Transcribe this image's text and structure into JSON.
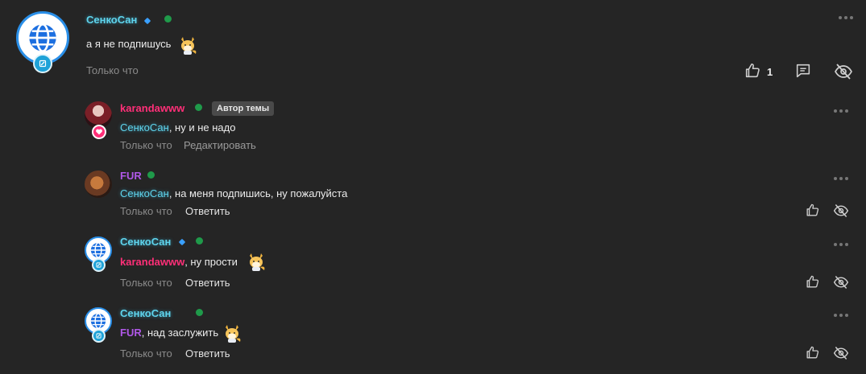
{
  "main_comment": {
    "author": "СенкоСан",
    "text": "а я не подпишусь",
    "time": "Только что",
    "like_count": "1"
  },
  "replies": [
    {
      "author": "karandawww",
      "author_badge": "Автор темы",
      "mention": "СенкоСан",
      "text": ", ну и не надо",
      "time": "Только что",
      "action": "Редактировать"
    },
    {
      "author": "FUR",
      "mention": "СенкоСан",
      "text": ", на меня подпишись, ну пожалуйста",
      "time": "Только что",
      "action": "Ответить"
    },
    {
      "author": "СенкоСан",
      "mention": "karandawww",
      "text": ", ну прости",
      "time": "Только что",
      "action": "Ответить"
    },
    {
      "author": "СенкоСан",
      "mention": "FUR",
      "text": ", над заслужить",
      "time": "Только что",
      "action": "Ответить"
    }
  ],
  "colors": {
    "background": "#252525",
    "senko_name": "#5fd4ec",
    "karandawww_name": "#ff2f78",
    "fur_name": "#b058e8",
    "online": "#1f9a4a"
  },
  "icons": [
    "globe-icon",
    "pen-icon",
    "heart-icon",
    "thumb-up-icon",
    "comment-icon",
    "eye-off-icon",
    "more-icon",
    "fox-sticker"
  ]
}
